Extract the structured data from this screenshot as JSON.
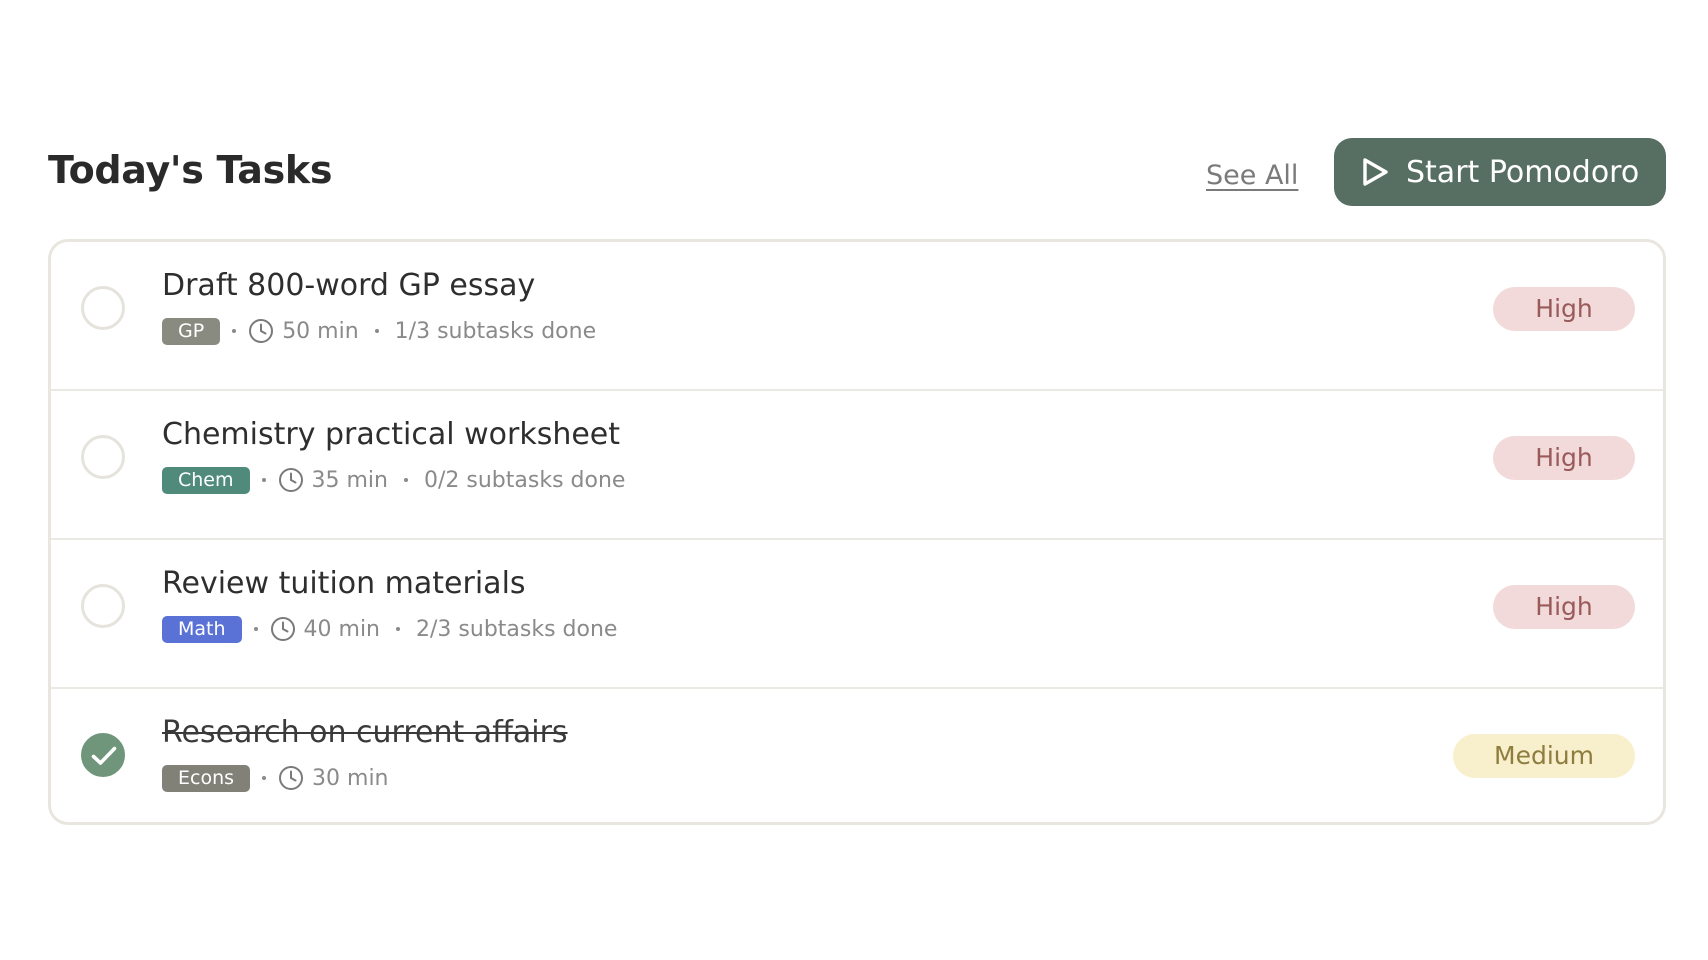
{
  "header": {
    "title": "Today's Tasks",
    "see_all_label": "See All",
    "start_button_label": "Start Pomodoro"
  },
  "colors": {
    "accent": "#566f62",
    "check_done": "#6f957a",
    "high_bg": "#f2dada",
    "medium_bg": "#f8efcc"
  },
  "tasks": [
    {
      "title": "Draft 800-word GP essay",
      "tag": "GP",
      "tag_color": "#8a8b80",
      "duration": "50 min",
      "subtasks": "1/3 subtasks done",
      "priority": "High",
      "completed": false
    },
    {
      "title": "Chemistry practical worksheet",
      "tag": "Chem",
      "tag_color": "#4f8a7a",
      "duration": "35 min",
      "subtasks": "0/2 subtasks done",
      "priority": "High",
      "completed": false
    },
    {
      "title": "Review tuition materials",
      "tag": "Math",
      "tag_color": "#5a72d6",
      "duration": "40 min",
      "subtasks": "2/3 subtasks done",
      "priority": "High",
      "completed": false
    },
    {
      "title": "Research on current affairs",
      "tag": "Econs",
      "tag_color": "#818178",
      "duration": "30 min",
      "subtasks": "",
      "priority": "Medium",
      "completed": true
    }
  ]
}
